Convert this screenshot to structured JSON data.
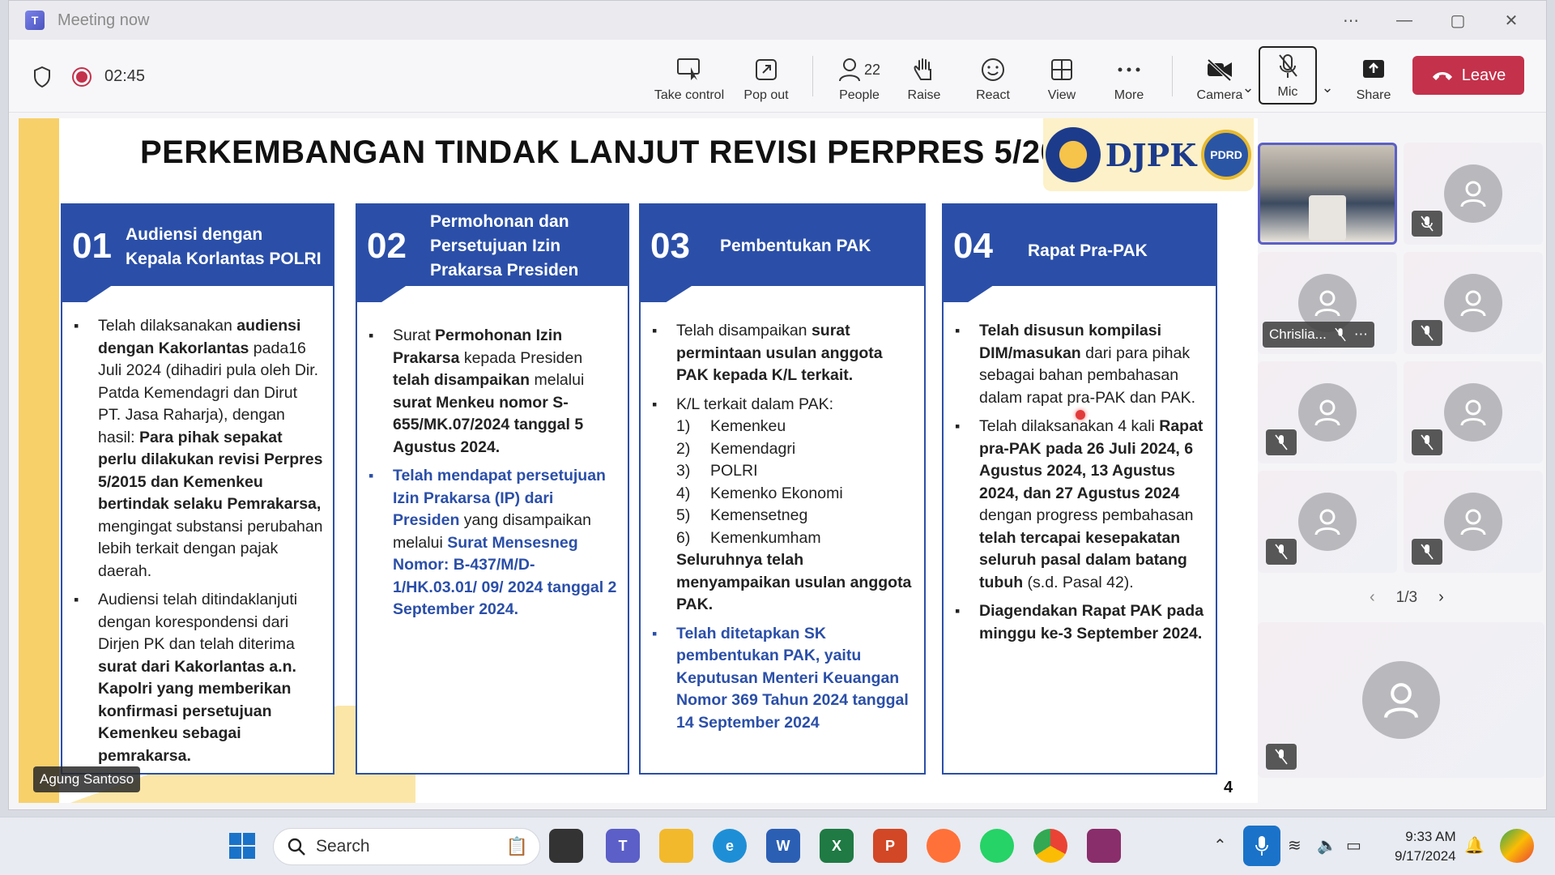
{
  "window": {
    "title": "Meeting now",
    "more_label": "⋯",
    "minimize": "—",
    "maximize": "▢",
    "close": "✕"
  },
  "toolbar": {
    "timer": "02:45",
    "take_control": "Take control",
    "pop_out": "Pop out",
    "people": "People",
    "people_count": "22",
    "raise": "Raise",
    "react": "React",
    "view": "View",
    "more": "More",
    "camera": "Camera",
    "mic": "Mic",
    "share": "Share",
    "leave": "Leave"
  },
  "slide": {
    "title": "PERKEMBANGAN TINDAK LANJUT REVISI PERPRES 5/2015",
    "logo_djpk": "DJPK",
    "logo_pdrd": "PDRD",
    "page_number": "4",
    "cards": [
      {
        "num": "01",
        "title_lines": [
          "Audiensi dengan",
          "Kepala Korlantas POLRI"
        ]
      },
      {
        "num": "02",
        "title_lines": [
          "Permohonan dan",
          "Persetujuan Izin",
          "Prakarsa Presiden"
        ]
      },
      {
        "num": "03",
        "title_lines": [
          "Pembentukan PAK"
        ]
      },
      {
        "num": "04",
        "title_lines": [
          "Rapat Pra-PAK"
        ]
      }
    ],
    "c1": {
      "b1_t1": "Telah dilaksanakan ",
      "b1_b1": "audiensi dengan Kakorlantas",
      "b1_t2": " pada16 Juli 2024 (dihadiri pula oleh Dir. Patda Kemendagri dan Dirut PT. Jasa Raharja), dengan hasil: ",
      "b1_b2": "Para pihak sepakat perlu dilakukan revisi Perpres 5/2015 dan Kemenkeu bertindak selaku Pemrakarsa,",
      "b1_t3": " mengingat substansi perubahan lebih terkait dengan pajak daerah.",
      "b2_t1": "Audiensi telah ditindaklanjuti dengan korespondensi dari Dirjen PK dan telah diterima ",
      "b2_b1": "surat dari Kakorlantas a.n. Kapolri yang memberikan konfirmasi persetujuan Kemenkeu sebagai pemrakarsa."
    },
    "c2": {
      "b1_t1": "Surat ",
      "b1_b1": "Permohonan Izin Prakarsa",
      "b1_t2": " kepada Presiden ",
      "b1_b2": "telah disampaikan",
      "b1_t3": " melalui ",
      "b1_b3": "surat Menkeu nomor S-655/MK.07/2024 tanggal 5 Agustus 2024.",
      "b2_b1": "Telah mendapat persetujuan Izin Prakarsa (IP) dari Presiden",
      "b2_t1": " yang disampaikan melalui ",
      "b2_b2": "Surat Mensesneg Nomor: B-437/M/D-1/HK.03.01/ 09/ 2024 tanggal 2 September 2024."
    },
    "c3": {
      "b1_t1": "Telah disampaikan ",
      "b1_b1": "surat permintaan usulan anggota PAK kepada K/L terkait.",
      "b2_t1": "K/L terkait dalam PAK:",
      "list": [
        {
          "n": "1)",
          "v": "Kemenkeu"
        },
        {
          "n": "2)",
          "v": "Kemendagri"
        },
        {
          "n": "3)",
          "v": "POLRI"
        },
        {
          "n": "4)",
          "v": "Kemenko Ekonomi"
        },
        {
          "n": "5)",
          "v": "Kemensetneg"
        },
        {
          "n": "6)",
          "v": "Kemenkumham"
        }
      ],
      "b2_b1": "Seluruhnya telah menyampaikan usulan anggota PAK.",
      "b3_b1": "Telah ditetapkan SK pembentukan PAK, yaitu Keputusan Menteri Keuangan Nomor 369 Tahun 2024 tanggal 14 September 2024"
    },
    "c4": {
      "b1_b1": "Telah disusun kompilasi DIM/masukan",
      "b1_t1": " dari para pihak sebagai bahan pembahasan dalam rapat pra-PAK dan PAK.",
      "b2_t1": "Telah dilaksanakan 4 kali ",
      "b2_b1": "Rapat pra-PAK pada 26 Juli 2024, 6 Agustus 2024, 13 Agustus 2024, dan 27 Agustus 2024",
      "b2_t2": " dengan progress pembahasan ",
      "b2_b2": "telah tercapai kesepakatan seluruh pasal dalam batang tubuh",
      "b2_t3": " (s.d. Pasal 42).",
      "b3_b1": "Diagendakan Rapat PAK pada minggu ke-3 September 2024."
    },
    "presenter_name": "Agung Santoso"
  },
  "participants": {
    "named_tile": "Chrislia...",
    "pager": "1/3"
  },
  "taskbar": {
    "search_label": "Search",
    "time": "9:33 AM",
    "date": "9/17/2024"
  },
  "colors": {
    "accent": "#5b5fc7",
    "leave": "#c4314b",
    "slide_blue": "#2b4fa8",
    "slide_yellow": "#f7d06a"
  }
}
